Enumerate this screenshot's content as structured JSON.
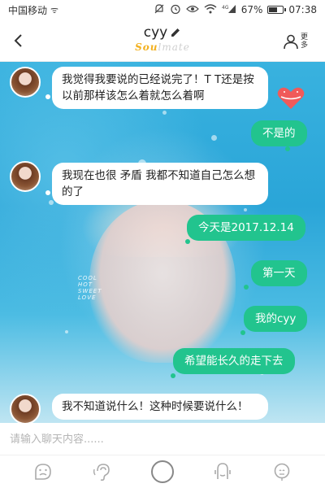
{
  "status_bar": {
    "carrier": "中国移动",
    "battery_percent": "67%",
    "battery_level": 0.67,
    "time": "07:38",
    "network": "4G",
    "icons": [
      "carrier-hd-icon",
      "mute-icon",
      "alarm-icon",
      "eye-icon",
      "wifi-icon",
      "signal-icon",
      "battery-icon"
    ]
  },
  "header": {
    "title": "cyy",
    "subtitle_part1": "Sou",
    "subtitle_part2": "lmate",
    "more_label": "更多",
    "icons": [
      "back-icon",
      "edit-icon",
      "user-icon"
    ]
  },
  "messages": [
    {
      "side": "left",
      "text": "我觉得我要说的已经说完了！T T还是按以前那样该怎么着就怎么着啊"
    },
    {
      "side": "right",
      "text": "不是的"
    },
    {
      "side": "left",
      "text": "我现在也很 矛盾  我都不知道自己怎么想的了"
    },
    {
      "side": "right",
      "text": "今天是2017.12.14"
    },
    {
      "side": "right",
      "text": "第一天"
    },
    {
      "side": "right",
      "text": "我的cyy"
    },
    {
      "side": "right",
      "text": "希望能长久的走下去"
    },
    {
      "side": "left",
      "text": "我不知道说什么！这种时候要说什么！"
    }
  ],
  "background_stamp": {
    "lines": [
      "COOL",
      "HOT",
      "SWEET",
      "LOVE"
    ]
  },
  "input": {
    "placeholder": "请输入聊天内容......"
  },
  "bottom_bar": {
    "icons": [
      "sad-face-icon",
      "ear-icon",
      "circle-button-icon",
      "head-icon",
      "face-icon"
    ]
  },
  "colors": {
    "accent_green": "#22c48e",
    "sky_blue": "#2aa5d8",
    "brand_yellow": "#f2b01e",
    "heart_red": "#f05a5a"
  }
}
